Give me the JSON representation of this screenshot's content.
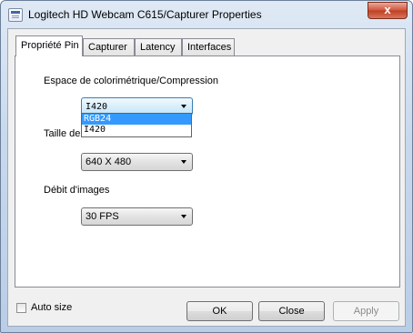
{
  "window": {
    "title": "Logitech HD Webcam C615/Capturer Properties",
    "close_glyph": "x"
  },
  "tabs": [
    {
      "label": "Propriété Pin",
      "active": true
    },
    {
      "label": "Capturer",
      "active": false
    },
    {
      "label": "Latency",
      "active": false
    },
    {
      "label": "Interfaces",
      "active": false
    }
  ],
  "panel": {
    "colorspace_label": "Espace de colorimétrique/Compression",
    "colorspace_value": "I420",
    "colorspace_options": [
      "RGB24",
      "I420"
    ],
    "colorspace_highlighted": "RGB24",
    "size_label": "Taille de",
    "size_value": "640 X 480",
    "framerate_label": "Débit d'images",
    "framerate_value": "30 FPS"
  },
  "footer": {
    "autosize_label": "Auto size",
    "autosize_checked": false,
    "ok_label": "OK",
    "close_label": "Close",
    "apply_label": "Apply"
  },
  "colors": {
    "selection": "#3399ff",
    "close_button": "#c13e22"
  }
}
